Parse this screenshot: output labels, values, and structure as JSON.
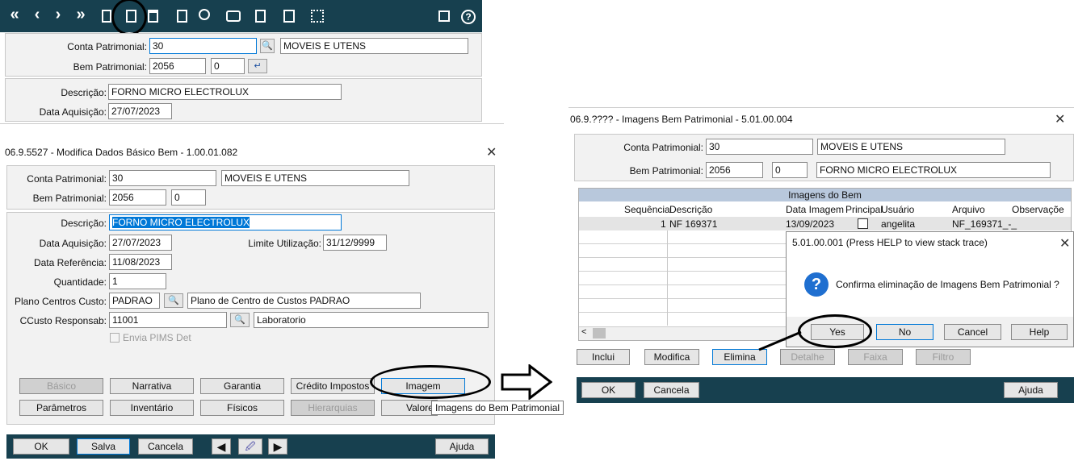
{
  "bg_window": {
    "toolbar_icons": [
      "first-icon",
      "prev-icon",
      "next-icon",
      "last-icon",
      "new-icon",
      "edit-icon",
      "delete-icon",
      "document-icon",
      "search-icon",
      "print-icon",
      "copy-icon",
      "image-icon",
      "building-icon",
      "exit-icon",
      "help-icon"
    ],
    "conta_label": "Conta Patrimonial:",
    "conta_value": "30",
    "conta_desc": "MOVEIS E UTENS",
    "bem_label": "Bem Patrimonial:",
    "bem_value": "2056",
    "bem_seq": "0",
    "descricao_label": "Descrição:",
    "descricao_value": "FORNO MICRO ELECTROLUX",
    "data_aquisicao_label": "Data Aquisição:",
    "data_aquisicao_value": "27/07/2023"
  },
  "left_dialog": {
    "title": "06.9.5527 - Modifica Dados Básico Bem - 1.00.01.082",
    "conta_label": "Conta Patrimonial:",
    "conta_value": "30",
    "conta_desc": "MOVEIS E UTENS",
    "bem_label": "Bem Patrimonial:",
    "bem_value": "2056",
    "bem_seq": "0",
    "descricao_label": "Descrição:",
    "descricao_value": "FORNO MICRO ELECTROLUX",
    "data_aquisicao_label": "Data Aquisição:",
    "data_aquisicao_value": "27/07/2023",
    "limite_label": "Limite Utilização:",
    "limite_value": "31/12/9999",
    "data_ref_label": "Data Referência:",
    "data_ref_value": "11/08/2023",
    "quantidade_label": "Quantidade:",
    "quantidade_value": "1",
    "plano_label": "Plano Centros Custo:",
    "plano_value": "PADRAO",
    "plano_desc": "Plano de Centro de Custos PADRAO",
    "ccusto_label": "CCusto Responsab:",
    "ccusto_value": "11001",
    "ccusto_desc": "Laboratorio",
    "envia_label": "Envia PIMS Det",
    "tabs_row1": [
      "Básico",
      "Narrativa",
      "Garantia",
      "Crédito Impostos",
      "Imagem"
    ],
    "tabs_row2": [
      "Parâmetros",
      "Inventário",
      "Físicos",
      "Hierarquias",
      "Valore"
    ],
    "tooltip": "Imagens do Bem Patrimonial",
    "ok": "OK",
    "salva": "Salva",
    "cancela": "Cancela",
    "ajuda": "Ajuda"
  },
  "arrow": "⇨",
  "right_dialog": {
    "title": "06.9.???? - Imagens Bem Patrimonial - 5.01.00.004",
    "conta_label": "Conta Patrimonial:",
    "conta_value": "30",
    "conta_desc": "MOVEIS E UTENS",
    "bem_label": "Bem Patrimonial:",
    "bem_value": "2056",
    "bem_seq": "0",
    "bem_desc": "FORNO MICRO ELECTROLUX",
    "grid_title": "Imagens do Bem",
    "columns": [
      "Sequência",
      "Descrição",
      "Data Imagem",
      "Principal",
      "Usuário",
      "Arquivo",
      "Observaçõe"
    ],
    "row": {
      "seq": "1",
      "descricao": "NF 169371",
      "data": "13/09/2023",
      "usuario": "angelita",
      "arquivo": "NF_169371_-_"
    },
    "buttons": [
      "Inclui",
      "Modifica",
      "Elimina",
      "Detalhe",
      "Faixa",
      "Filtro"
    ],
    "ok": "OK",
    "cancela": "Cancela",
    "ajuda": "Ajuda"
  },
  "message_box": {
    "title": "5.01.00.001 (Press HELP to view stack trace)",
    "message": "Confirma eliminação de Imagens Bem Patrimonial ?",
    "icon": "question-icon",
    "yes": "Yes",
    "no": "No",
    "cancel": "Cancel",
    "help": "Help"
  }
}
